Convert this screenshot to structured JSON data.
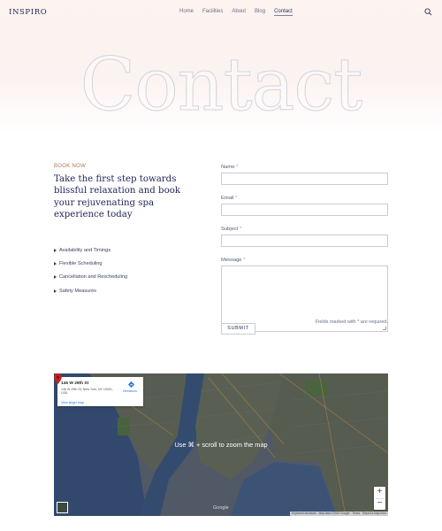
{
  "header": {
    "logo": "INSPIRO",
    "nav": [
      {
        "label": "Home"
      },
      {
        "label": "Facilities"
      },
      {
        "label": "About"
      },
      {
        "label": "Blog"
      },
      {
        "label": "Contact",
        "active": true
      }
    ],
    "search_icon": "search-icon"
  },
  "hero": {
    "title": "Contact"
  },
  "intro": {
    "eyebrow": "BOOK NOW",
    "heading": "Take the first step towards blissful relaxation and book your rejuvenating spa experience today",
    "features": [
      "Availability and Timings",
      "Flexible Scheduling",
      "Cancellation and Rescheduling",
      "Safety Measures"
    ]
  },
  "form": {
    "name_label": "Name",
    "email_label": "Email",
    "subject_label": "Subject",
    "message_label": "Message",
    "required_mark": "*",
    "name_value": "",
    "email_value": "",
    "subject_value": "",
    "message_value": "",
    "note": "Fields marked with * are required.",
    "submit_label": "SUBMIT"
  },
  "map": {
    "place_title": "146 W 29th St",
    "place_address": "146 W 29th St, New York, NY 10001, USA",
    "directions_label": "Directions",
    "larger_map_label": "View larger map",
    "hint": "Use ⌘ + scroll to zoom the map",
    "attribution": "Google",
    "footer": {
      "shortcuts": "Keyboard shortcuts",
      "mapdata": "Map data ©2023 Google",
      "terms": "Terms",
      "report": "Report a map error"
    },
    "zoom_in": "+",
    "zoom_out": "−",
    "pin_color": "#c5221f"
  },
  "colors": {
    "accent": "#b0785e",
    "heading": "#1f2557",
    "link": "#1a73e8"
  }
}
